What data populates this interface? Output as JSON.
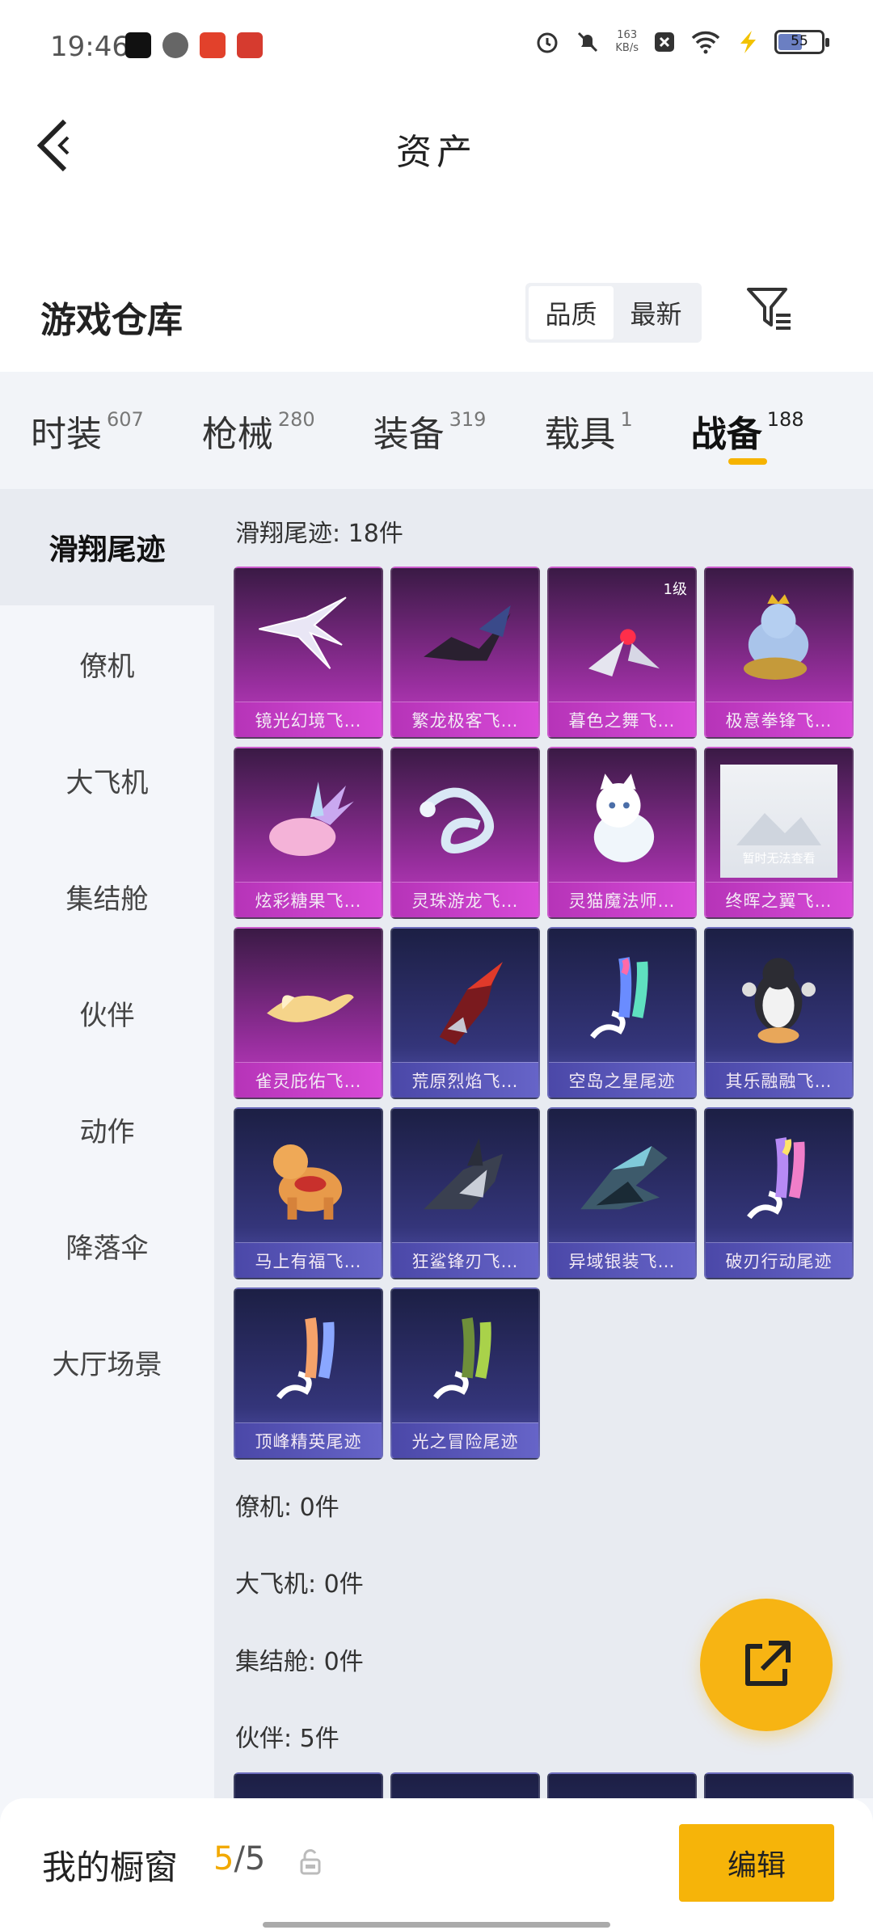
{
  "status_bar": {
    "time": "19:46",
    "net_speed_value": "163",
    "net_speed_unit": "KB/s",
    "battery_level": "55",
    "apps": [
      {
        "name": "music-app-icon",
        "color": "#111111"
      },
      {
        "name": "browser-app-icon",
        "color": "#555555"
      },
      {
        "name": "shop-app-icon",
        "color": "#e2412b"
      },
      {
        "name": "cash-app-icon",
        "color": "#d63b2f"
      }
    ]
  },
  "header": {
    "title": "资产"
  },
  "warehouse": {
    "title": "游戏仓库",
    "sort_quality": "品质",
    "sort_newest": "最新"
  },
  "tabs": [
    {
      "label": "时装",
      "count": "607"
    },
    {
      "label": "枪械",
      "count": "280"
    },
    {
      "label": "装备",
      "count": "319"
    },
    {
      "label": "载具",
      "count": "1"
    },
    {
      "label": "战备",
      "count": "188",
      "active": true
    }
  ],
  "sidebar": [
    {
      "label": "滑翔尾迹",
      "active": true
    },
    {
      "label": "僚机"
    },
    {
      "label": "大飞机"
    },
    {
      "label": "集结舱"
    },
    {
      "label": "伙伴"
    },
    {
      "label": "动作"
    },
    {
      "label": "降落伞"
    },
    {
      "label": "大厅场景"
    }
  ],
  "sections": {
    "glide_trail": "滑翔尾迹: 18件",
    "wingman": "僚机: 0件",
    "big_plane": "大飞机: 0件",
    "assembly_pod": "集结舱: 0件",
    "partner": "伙伴: 5件"
  },
  "items": [
    {
      "name": "镜光幻境飞…",
      "rarity": "purple",
      "icon": "crystal-wing-icon"
    },
    {
      "name": "繁龙极客飞…",
      "rarity": "purple",
      "icon": "dark-dragon-icon"
    },
    {
      "name": "暮色之舞飞…",
      "rarity": "purple",
      "icon": "dusk-dance-icon",
      "badge": "1级"
    },
    {
      "name": "极意拳锋飞…",
      "rarity": "purple",
      "icon": "elephant-boxer-icon"
    },
    {
      "name": "炫彩糖果飞…",
      "rarity": "purple",
      "icon": "candy-icon"
    },
    {
      "name": "灵珠游龙飞…",
      "rarity": "purple",
      "icon": "white-dragon-icon"
    },
    {
      "name": "灵猫魔法师…",
      "rarity": "purple",
      "icon": "magic-cat-icon"
    },
    {
      "name": "终晖之翼飞…",
      "rarity": "purple",
      "icon": "placeholder-image-icon",
      "placeholder": "暂时无法查看"
    },
    {
      "name": "雀灵庇佑飞…",
      "rarity": "purple",
      "icon": "golden-bird-icon"
    },
    {
      "name": "荒原烈焰飞…",
      "rarity": "blue",
      "icon": "flame-glider-icon"
    },
    {
      "name": "空岛之星尾迹",
      "rarity": "blue",
      "icon": "rainbow-trail-icon"
    },
    {
      "name": "其乐融融飞…",
      "rarity": "blue",
      "icon": "penguin-icon"
    },
    {
      "name": "马上有福飞…",
      "rarity": "blue",
      "icon": "pony-icon"
    },
    {
      "name": "狂鲨锋刃飞…",
      "rarity": "blue",
      "icon": "shark-icon"
    },
    {
      "name": "异域银装飞…",
      "rarity": "blue",
      "icon": "silver-wing-icon"
    },
    {
      "name": "破刃行动尾迹",
      "rarity": "blue",
      "icon": "pastel-trail-icon"
    },
    {
      "name": "顶峰精英尾迹",
      "rarity": "blue",
      "icon": "elite-trail-icon"
    },
    {
      "name": "光之冒险尾迹",
      "rarity": "blue",
      "icon": "green-trail-icon"
    }
  ],
  "bottom_bar": {
    "showcase_label": "我的橱窗",
    "showcase_current": "5",
    "showcase_total": "/5",
    "edit_label": "编辑"
  }
}
